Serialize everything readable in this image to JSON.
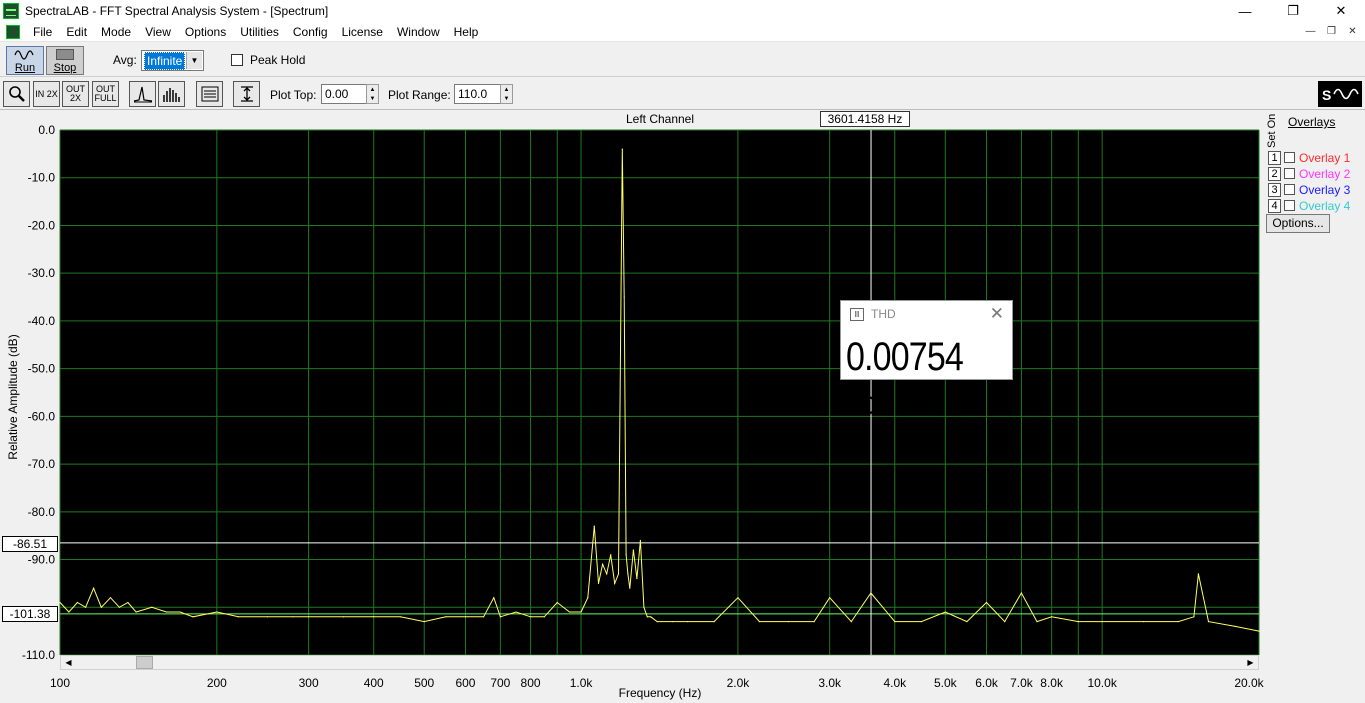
{
  "window": {
    "title": "SpectraLAB - FFT Spectral Analysis System - [Spectrum]",
    "minimize": "—",
    "maximize": "❐",
    "close": "✕"
  },
  "menu": [
    "File",
    "Edit",
    "Mode",
    "View",
    "Options",
    "Utilities",
    "Config",
    "License",
    "Window",
    "Help"
  ],
  "toolbar": {
    "run_label": "Run",
    "stop_label": "Stop",
    "avg_label": "Avg:",
    "avg_value": "Infinite",
    "peak_hold_label": "Peak Hold",
    "zoom_in_label": "IN 2X",
    "zoom_out_label": "OUT 2X",
    "zoom_full_label": "OUT FULL",
    "plot_top_label": "Plot Top:",
    "plot_top_value": "0.00",
    "plot_range_label": "Plot Range:",
    "plot_range_value": "110.0"
  },
  "chart": {
    "title": "Left Channel",
    "cursor_readout": "3601.4158 Hz",
    "ylabel": "Relative Amplitude (dB)",
    "xlabel": "Frequency (Hz)",
    "marker_upper": "-86.51",
    "marker_lower": "-101.38"
  },
  "chart_data": {
    "type": "line",
    "title": "Left Channel",
    "xlabel": "Frequency (Hz)",
    "ylabel": "Relative Amplitude (dB)",
    "x_scale": "log",
    "xlim": [
      100,
      20000
    ],
    "ylim": [
      -110,
      0
    ],
    "y_ticks": [
      "0.0",
      "-10.0",
      "-20.0",
      "-30.0",
      "-40.0",
      "-50.0",
      "-60.0",
      "-70.0",
      "-80.0",
      "-90.0",
      "-110.0"
    ],
    "x_ticks": [
      "100",
      "200",
      "300",
      "400",
      "500",
      "600",
      "700",
      "800",
      "1.0k",
      "2.0k",
      "3.0k",
      "4.0k",
      "5.0k",
      "6.0k",
      "7.0k",
      "8.0k",
      "10.0k",
      "20.0k"
    ],
    "grid": true,
    "background": "#000000",
    "line_color": "#ffff66",
    "grid_color": "#1f7a1f",
    "cursor_frequency": 3601.4158,
    "marker_levels": [
      -86.51,
      -101.38
    ],
    "series": [
      {
        "x": [
          100,
          104,
          108,
          112,
          116,
          120,
          125,
          130,
          135,
          140,
          150,
          160,
          170,
          180,
          200,
          220,
          250,
          280,
          300,
          350,
          400,
          450,
          500,
          550,
          600,
          650,
          680,
          700,
          750,
          800,
          850,
          900,
          950,
          1000,
          1030,
          1060,
          1080,
          1100,
          1120,
          1140,
          1160,
          1180,
          1200,
          1210,
          1220,
          1230,
          1240,
          1260,
          1280,
          1300,
          1320,
          1340,
          1360,
          1400,
          1500,
          1600,
          1800,
          2000,
          2200,
          2500,
          2800,
          3000,
          3300,
          3600,
          4000,
          4500,
          5000,
          5500,
          6000,
          6500,
          7000,
          7500,
          8000,
          9000,
          10000,
          12000,
          14000,
          15000,
          15300,
          16000,
          18000,
          20000
        ],
        "y": [
          -99,
          -101,
          -99,
          -100,
          -96,
          -100,
          -98,
          -100,
          -99,
          -101,
          -100,
          -101,
          -101,
          -102,
          -101,
          -102,
          -102,
          -102,
          -102,
          -102,
          -102,
          -102,
          -103,
          -102,
          -102,
          -102,
          -98,
          -102,
          -101,
          -102,
          -102,
          -99,
          -101,
          -101,
          -98,
          -83,
          -95,
          -91,
          -93,
          -89,
          -95,
          -93,
          -4,
          -35,
          -89,
          -93,
          -96,
          -88,
          -94,
          -86,
          -100,
          -102,
          -102,
          -103,
          -103,
          -103,
          -103,
          -98,
          -103,
          -103,
          -103,
          -98,
          -103,
          -97,
          -103,
          -103,
          -101,
          -103,
          -99,
          -103,
          -97,
          -103,
          -102,
          -103,
          -103,
          -103,
          -103,
          -102,
          -93,
          -103,
          -104,
          -105
        ]
      }
    ]
  },
  "overlays": {
    "title": "Overlays",
    "set_label": "Set On",
    "items": [
      {
        "num": "1",
        "name": "Overlay 1",
        "color": "#ff2a2a"
      },
      {
        "num": "2",
        "name": "Overlay 2",
        "color": "#ff33ff"
      },
      {
        "num": "3",
        "name": "Overlay 3",
        "color": "#1a1aff"
      },
      {
        "num": "4",
        "name": "Overlay 4",
        "color": "#33cccc"
      }
    ],
    "options_label": "Options..."
  },
  "thd": {
    "title": "THD",
    "value": "0.00754 %"
  }
}
